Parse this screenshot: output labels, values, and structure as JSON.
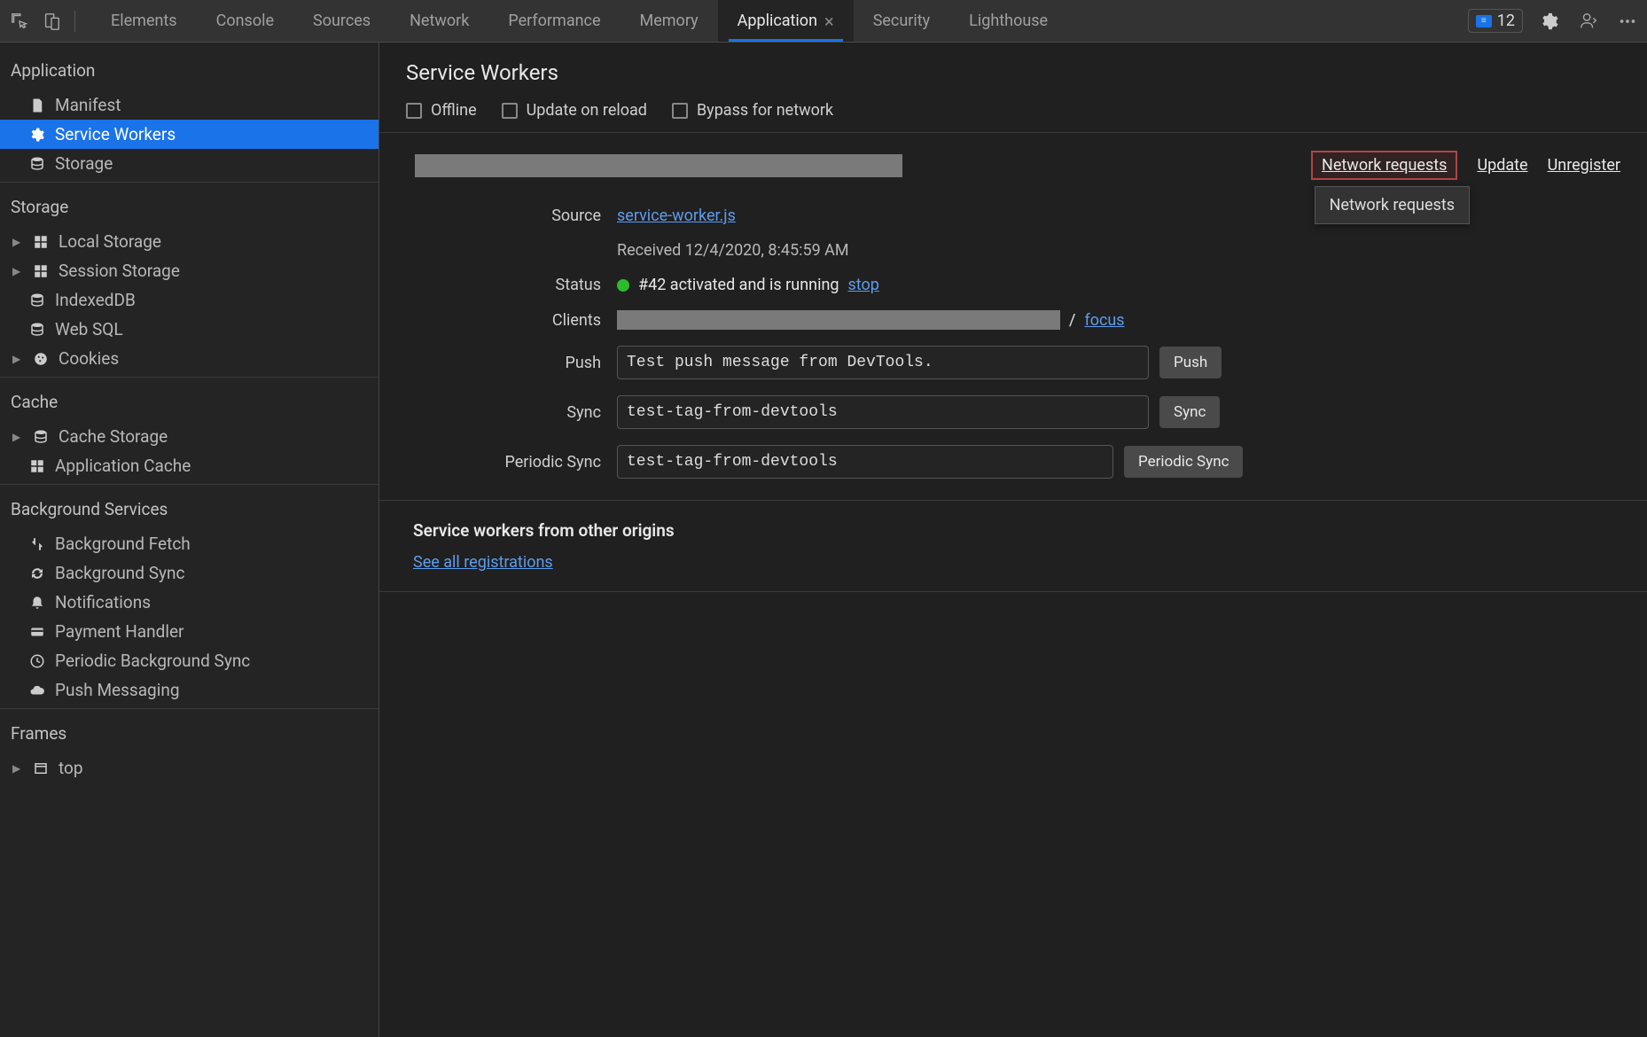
{
  "toolbar": {
    "tabs": [
      "Elements",
      "Console",
      "Sources",
      "Network",
      "Performance",
      "Memory",
      "Application",
      "Security",
      "Lighthouse"
    ],
    "active_tab": "Application",
    "badge_count": "12"
  },
  "sidebar": {
    "sections": [
      {
        "title": "Application",
        "items": [
          {
            "label": "Manifest",
            "icon": "document-icon"
          },
          {
            "label": "Service Workers",
            "icon": "gear-icon",
            "selected": true
          },
          {
            "label": "Storage",
            "icon": "database-icon"
          }
        ]
      },
      {
        "title": "Storage",
        "items": [
          {
            "label": "Local Storage",
            "icon": "grid-icon",
            "expandable": true
          },
          {
            "label": "Session Storage",
            "icon": "grid-icon",
            "expandable": true
          },
          {
            "label": "IndexedDB",
            "icon": "database-icon"
          },
          {
            "label": "Web SQL",
            "icon": "database-icon"
          },
          {
            "label": "Cookies",
            "icon": "cookie-icon",
            "expandable": true
          }
        ]
      },
      {
        "title": "Cache",
        "items": [
          {
            "label": "Cache Storage",
            "icon": "database-icon",
            "expandable": true
          },
          {
            "label": "Application Cache",
            "icon": "grid-icon"
          }
        ]
      },
      {
        "title": "Background Services",
        "items": [
          {
            "label": "Background Fetch",
            "icon": "fetch-icon"
          },
          {
            "label": "Background Sync",
            "icon": "sync-icon"
          },
          {
            "label": "Notifications",
            "icon": "bell-icon"
          },
          {
            "label": "Payment Handler",
            "icon": "card-icon"
          },
          {
            "label": "Periodic Background Sync",
            "icon": "clock-icon"
          },
          {
            "label": "Push Messaging",
            "icon": "cloud-icon"
          }
        ]
      },
      {
        "title": "Frames",
        "items": [
          {
            "label": "top",
            "icon": "frame-icon",
            "expandable": true
          }
        ]
      }
    ]
  },
  "content": {
    "title": "Service Workers",
    "checkboxes": [
      "Offline",
      "Update on reload",
      "Bypass for network"
    ],
    "actions": {
      "network_requests": "Network requests",
      "update": "Update",
      "unregister": "Unregister"
    },
    "tooltip": "Network requests",
    "details": {
      "source_label": "Source",
      "source_file": "service-worker.js",
      "received_text": "Received 12/4/2020, 8:45:59 AM",
      "status_label": "Status",
      "status_text": "#42 activated and is running",
      "stop_link": "stop",
      "clients_label": "Clients",
      "clients_slash": "/",
      "focus_link": "focus",
      "push_label": "Push",
      "push_value": "Test push message from DevTools.",
      "push_button": "Push",
      "sync_label": "Sync",
      "sync_value": "test-tag-from-devtools",
      "sync_button": "Sync",
      "periodic_label": "Periodic Sync",
      "periodic_value": "test-tag-from-devtools",
      "periodic_button": "Periodic Sync"
    },
    "other_origins": {
      "title": "Service workers from other origins",
      "link": "See all registrations"
    }
  }
}
